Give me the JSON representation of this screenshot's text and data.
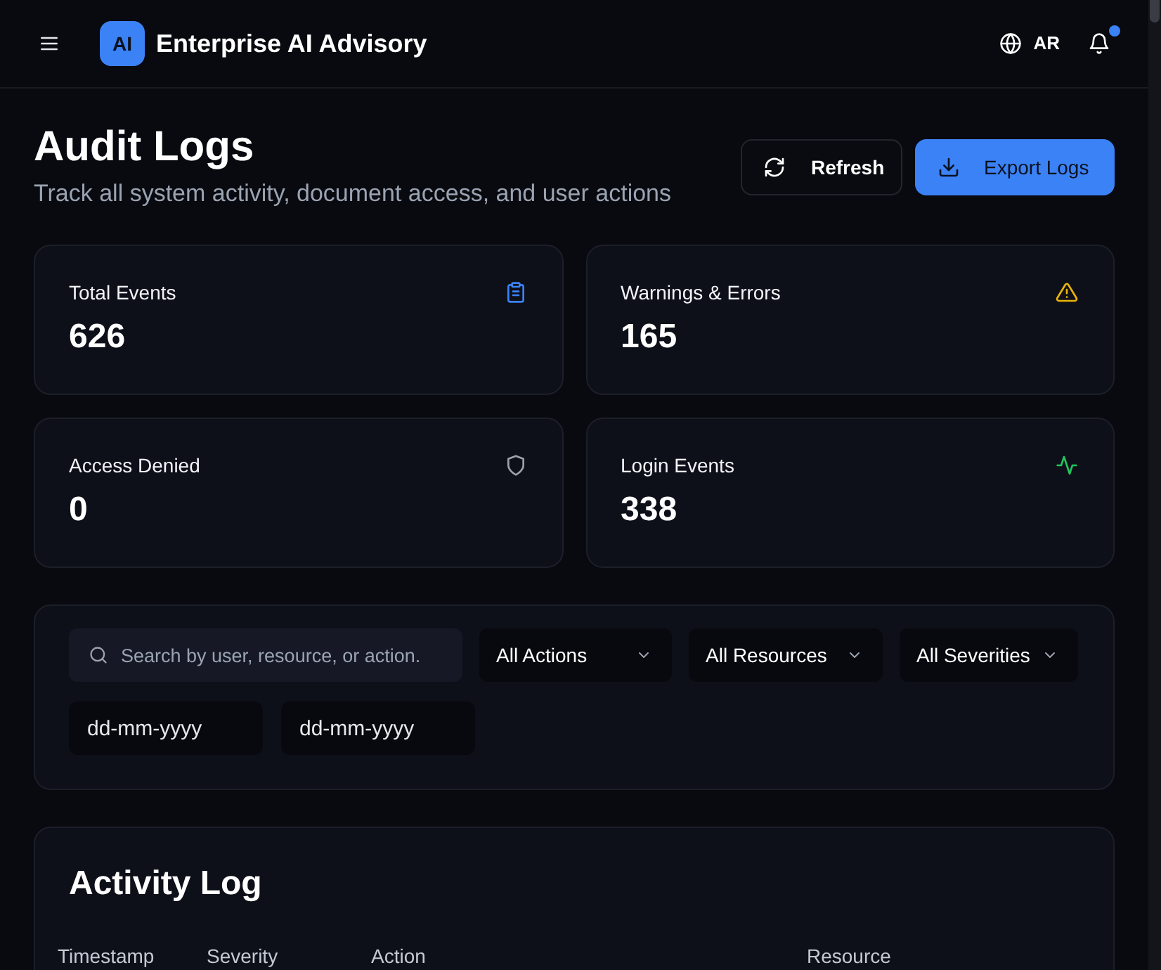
{
  "header": {
    "logo": "AI",
    "title": "Enterprise AI Advisory",
    "language": "AR",
    "unread_notifications": true
  },
  "page": {
    "title": "Audit Logs",
    "subtitle": "Track all system activity, document access, and user actions"
  },
  "actions": [
    {
      "label": "Refresh",
      "kind": "refresh"
    },
    {
      "label": "Export Logs",
      "kind": "export"
    }
  ],
  "stats": [
    {
      "label": "Total Events",
      "value": "626",
      "kind": "clipboard",
      "color": "#3b82f6"
    },
    {
      "label": "Warnings & Errors",
      "value": "165",
      "kind": "warning",
      "color": "#eab308"
    },
    {
      "label": "Access Denied",
      "value": "0",
      "kind": "shield",
      "color": "#9ca3af"
    },
    {
      "label": "Login Events",
      "value": "338",
      "kind": "activity",
      "color": "#22c55e"
    }
  ],
  "filters": {
    "search": {
      "placeholder": "Search by user, resource, or action."
    },
    "selects": [
      {
        "value": "All Actions"
      },
      {
        "value": "All Resources"
      },
      {
        "value": "All Severities"
      }
    ],
    "date_fields": [
      {
        "placeholder": "dd-mm-yyyy"
      },
      {
        "placeholder": "dd-mm-yyyy"
      }
    ]
  },
  "activity_log": {
    "title": "Activity Log",
    "columns": [
      "Timestamp",
      "Severity",
      "Action",
      "Resource"
    ]
  }
}
